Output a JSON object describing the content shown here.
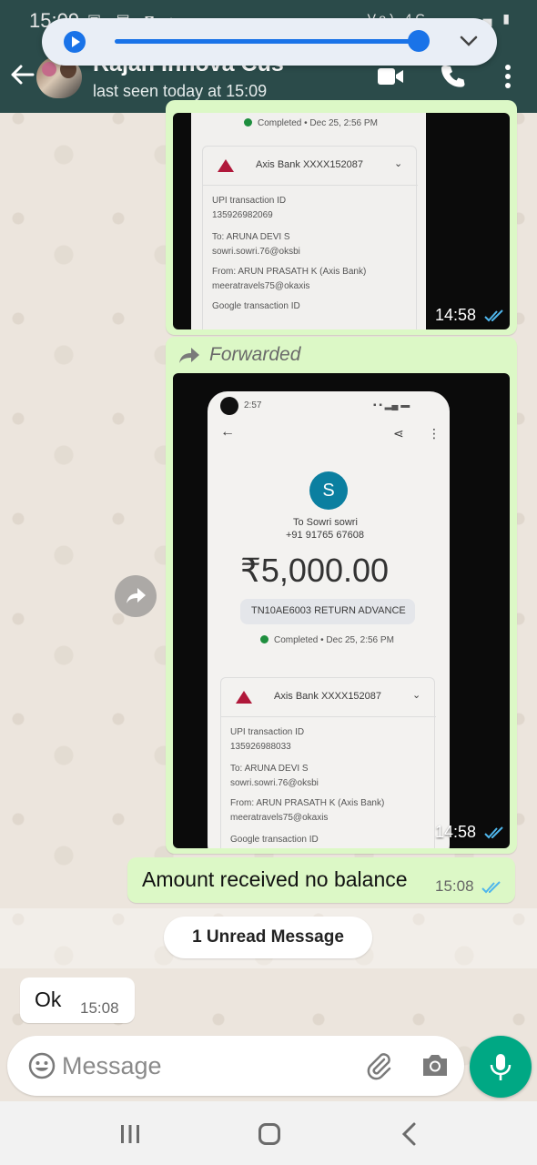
{
  "status_bar": {
    "time": "15:09",
    "left_icons": "▣ ▤ ◘ •",
    "right_icons": "Vo) 4G ▂▄ ▂▄ ▮"
  },
  "header": {
    "contact_name": "Rajan Innova Cus",
    "last_seen": "last seen today at 15:09"
  },
  "media_player": {
    "progress": 0.97
  },
  "messages": {
    "photo1": {
      "completed": "Completed • Dec 25, 2:56 PM",
      "bank": "Axis Bank XXXX152087",
      "txn_id_label": "UPI transaction ID",
      "txn_id": "135926982069",
      "to_label": "To: ARUNA DEVI S",
      "to_upi": "sowri.sowri.76@oksbi",
      "from_label": "From: ARUN PRASATH K (Axis Bank)",
      "from_upi": "meeratravels75@okaxis",
      "google_txn": "Google transaction ID",
      "time": "14:58"
    },
    "forwarded_label": "Forwarded",
    "photo2": {
      "phone_time": "2:57",
      "avatar_letter": "S",
      "to_name": "To Sowri sowri",
      "phone_number": "+91 91765 67608",
      "amount": "₹5,000.00",
      "note": "TN10AE6003 RETURN ADVANCE",
      "completed": "Completed • Dec 25, 2:56 PM",
      "bank": "Axis Bank XXXX152087",
      "txn_id_label": "UPI transaction ID",
      "txn_id": "135926988033",
      "to_label": "To: ARUNA DEVI S",
      "to_upi": "sowri.sowri.76@oksbi",
      "from_label": "From: ARUN PRASATH K (Axis Bank)",
      "from_upi": "meeratravels75@okaxis",
      "google_txn": "Google transaction ID",
      "time": "14:58"
    },
    "outgoing_text": {
      "text": "Amount received no balance",
      "time": "15:08"
    },
    "unread_label": "1 Unread Message",
    "incoming_text": {
      "text": "Ok",
      "time": "15:08"
    }
  },
  "composer": {
    "placeholder": "Message"
  },
  "colors": {
    "header": "#2b4b4a",
    "outgoing_bubble": "#dcf8c6",
    "mic_button": "#00a884",
    "read_ticks": "#4fb6ec",
    "media_accent": "#1a73e8"
  }
}
